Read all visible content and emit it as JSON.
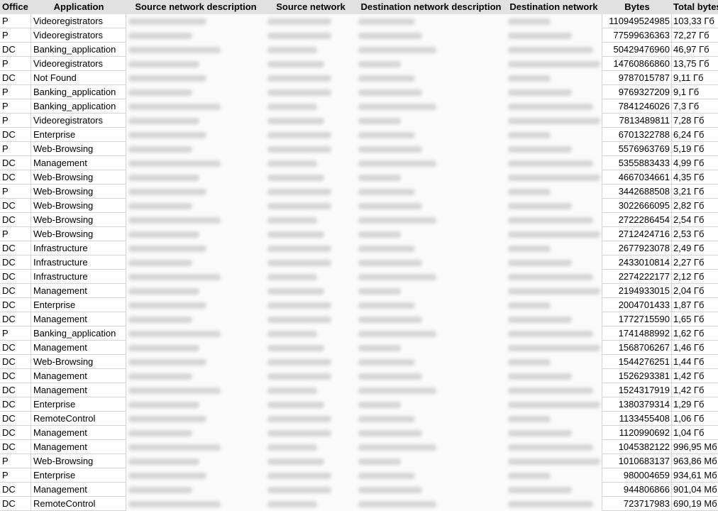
{
  "headers": {
    "office": "Office",
    "application": "Application",
    "source_network_description": "Source network description",
    "source_network": "Source network",
    "destination_network_description": "Destination network description",
    "destination_network": "Destination network",
    "bytes": "Bytes",
    "total_bytes": "Total bytes"
  },
  "obscured_columns_note": "Source/destination network columns are blurred (redacted)",
  "rows": [
    {
      "office": "P",
      "application": "Videoregistrators",
      "bytes": "110949524985",
      "total": "103,33 Гб"
    },
    {
      "office": "P",
      "application": "Videoregistrators",
      "bytes": "77599636363",
      "total": "72,27 Гб"
    },
    {
      "office": "DC",
      "application": "Banking_application",
      "bytes": "50429476960",
      "total": "46,97 Гб"
    },
    {
      "office": "P",
      "application": "Videoregistrators",
      "bytes": "14760866860",
      "total": "13,75 Гб"
    },
    {
      "office": "DC",
      "application": "Not Found",
      "bytes": "9787015787",
      "total": "9,11 Гб"
    },
    {
      "office": "P",
      "application": "Banking_application",
      "bytes": "9769327209",
      "total": "9,1 Гб"
    },
    {
      "office": "P",
      "application": "Banking_application",
      "bytes": "7841246026",
      "total": "7,3 Гб"
    },
    {
      "office": "P",
      "application": "Videoregistrators",
      "bytes": "7813489811",
      "total": "7,28 Гб"
    },
    {
      "office": "DC",
      "application": "Enterprise",
      "bytes": "6701322788",
      "total": "6,24 Гб"
    },
    {
      "office": "P",
      "application": "Web-Browsing",
      "bytes": "5576963769",
      "total": "5,19 Гб"
    },
    {
      "office": "DC",
      "application": "Management",
      "bytes": "5355883433",
      "total": "4,99 Гб"
    },
    {
      "office": "DC",
      "application": "Web-Browsing",
      "bytes": "4667034661",
      "total": "4,35 Гб"
    },
    {
      "office": "P",
      "application": "Web-Browsing",
      "bytes": "3442688508",
      "total": "3,21 Гб"
    },
    {
      "office": "DC",
      "application": "Web-Browsing",
      "bytes": "3022666095",
      "total": "2,82 Гб"
    },
    {
      "office": "DC",
      "application": "Web-Browsing",
      "bytes": "2722286454",
      "total": "2,54 Гб"
    },
    {
      "office": "P",
      "application": "Web-Browsing",
      "bytes": "2712424716",
      "total": "2,53 Гб"
    },
    {
      "office": "DC",
      "application": "Infrastructure",
      "bytes": "2677923078",
      "total": "2,49 Гб"
    },
    {
      "office": "DC",
      "application": "Infrastructure",
      "bytes": "2433010814",
      "total": "2,27 Гб"
    },
    {
      "office": "DC",
      "application": "Infrastructure",
      "bytes": "2274222177",
      "total": "2,12 Гб"
    },
    {
      "office": "DC",
      "application": "Management",
      "bytes": "2194933015",
      "total": "2,04 Гб"
    },
    {
      "office": "DC",
      "application": "Enterprise",
      "bytes": "2004701433",
      "total": "1,87 Гб"
    },
    {
      "office": "DC",
      "application": "Management",
      "bytes": "1772715590",
      "total": "1,65 Гб"
    },
    {
      "office": "P",
      "application": "Banking_application",
      "bytes": "1741488992",
      "total": "1,62 Гб"
    },
    {
      "office": "DC",
      "application": "Management",
      "bytes": "1568706267",
      "total": "1,46 Гб"
    },
    {
      "office": "DC",
      "application": "Web-Browsing",
      "bytes": "1544276251",
      "total": "1,44 Гб"
    },
    {
      "office": "DC",
      "application": "Management",
      "bytes": "1526293381",
      "total": "1,42 Гб"
    },
    {
      "office": "DC",
      "application": "Management",
      "bytes": "1524317919",
      "total": "1,42 Гб"
    },
    {
      "office": "DC",
      "application": "Enterprise",
      "bytes": "1380379314",
      "total": "1,29 Гб"
    },
    {
      "office": "DC",
      "application": "RemoteControl",
      "bytes": "1133455408",
      "total": "1,06 Гб"
    },
    {
      "office": "DC",
      "application": "Management",
      "bytes": "1120990692",
      "total": "1,04 Гб"
    },
    {
      "office": "DC",
      "application": "Management",
      "bytes": "1045382122",
      "total": "996,95 Мб"
    },
    {
      "office": "P",
      "application": "Web-Browsing",
      "bytes": "1010683137",
      "total": "963,86 Мб"
    },
    {
      "office": "P",
      "application": "Enterprise",
      "bytes": "980004659",
      "total": "934,61 Мб"
    },
    {
      "office": "DC",
      "application": "Management",
      "bytes": "944806866",
      "total": "901,04 Мб"
    },
    {
      "office": "DC",
      "application": "RemoteControl",
      "bytes": "723717983",
      "total": "690,19 Мб"
    }
  ]
}
